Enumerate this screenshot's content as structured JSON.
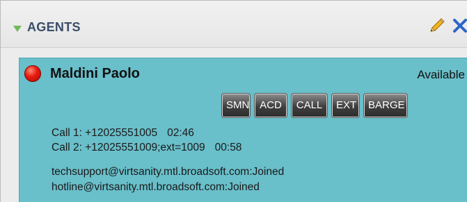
{
  "panel": {
    "title": "AGENTS",
    "icons": {
      "collapse": "triangle-down-icon",
      "edit": "pencil-icon",
      "close": "close-x-icon"
    },
    "colors": {
      "header_text": "#3a4e6a",
      "collapse_triangle": "#71b95b",
      "card_background": "#69bfca",
      "status_unavailable": "#e81c10",
      "close_icon": "#2a66c9"
    }
  },
  "agent": {
    "name": "Maldini Paolo",
    "status": "Available",
    "status_icon": "red-status-dot-icon",
    "buttons": [
      {
        "label": "SMN"
      },
      {
        "label": "ACD"
      },
      {
        "label": "CALL"
      },
      {
        "label": "EXT"
      },
      {
        "label": "BARGE"
      }
    ],
    "calls": [
      {
        "label": "Call 1: +12025551005",
        "time": "02:46"
      },
      {
        "label": "Call 2: +12025551009;ext=1009",
        "time": "00:58"
      }
    ],
    "queues": [
      "techsupport@virtsanity.mtl.broadsoft.com:Joined",
      "hotline@virtsanity.mtl.broadsoft.com:Joined"
    ]
  }
}
